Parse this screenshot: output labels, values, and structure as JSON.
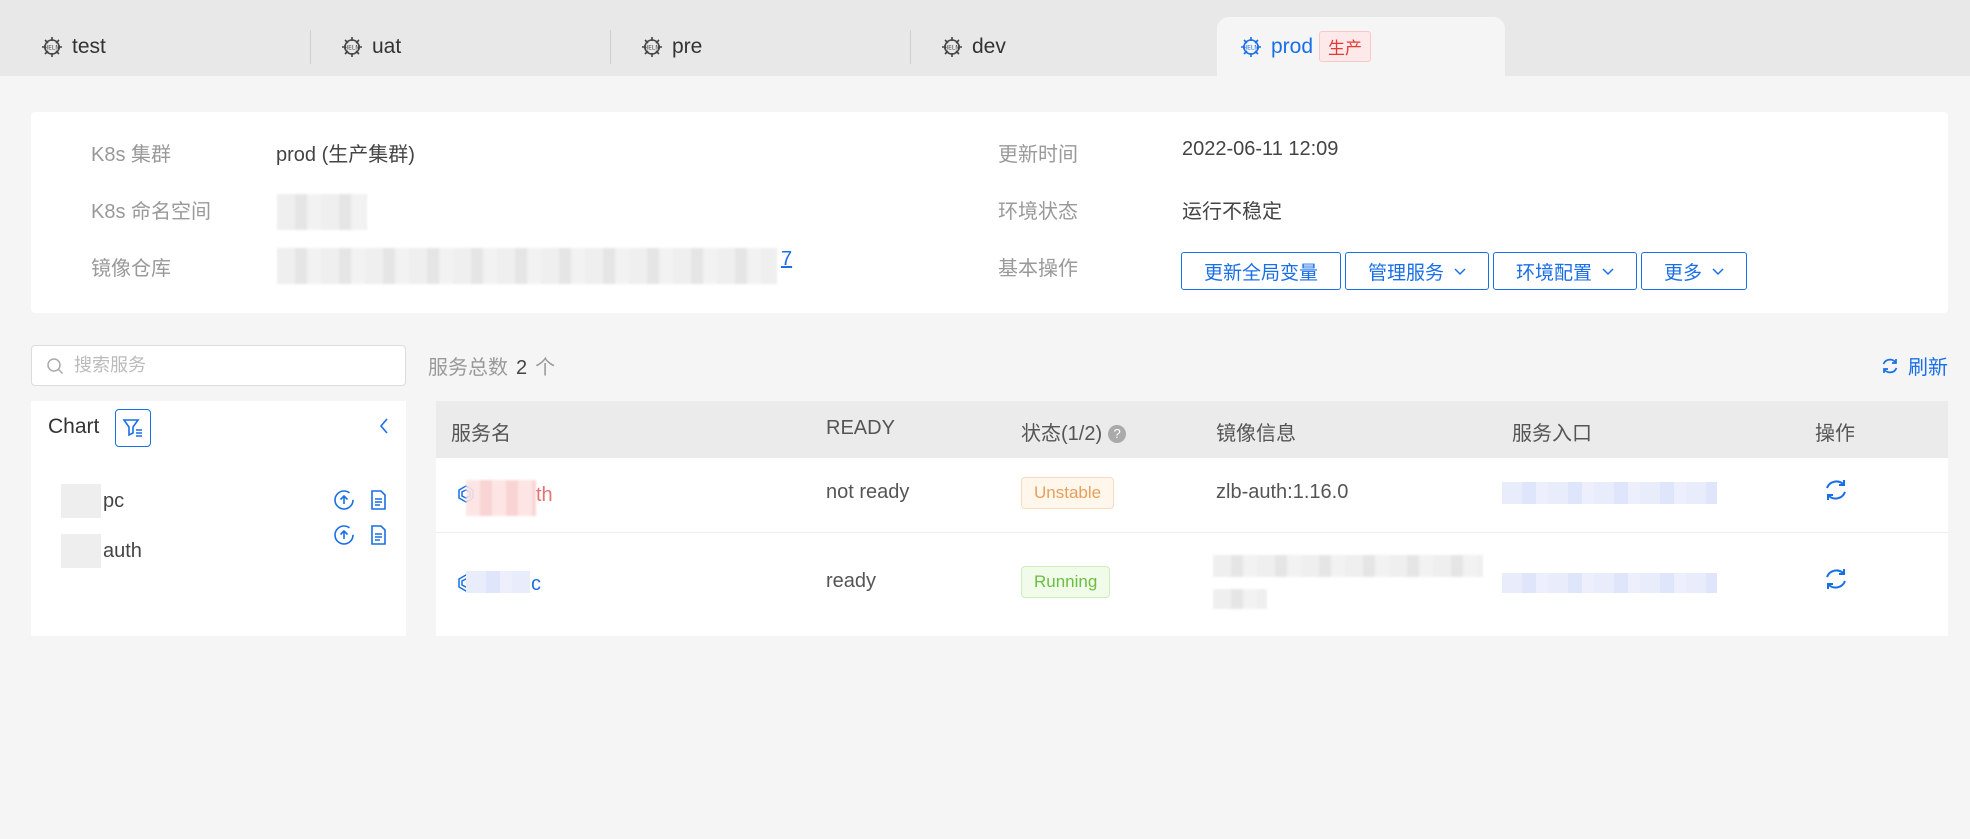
{
  "tabs": [
    {
      "label": "test"
    },
    {
      "label": "uat"
    },
    {
      "label": "pre"
    },
    {
      "label": "dev"
    },
    {
      "label": "prod",
      "tag": "生产",
      "active": true
    }
  ],
  "info": {
    "cluster_label": "K8s 集群",
    "cluster_value": "prod (生产集群)",
    "namespace_label": "K8s 命名空间",
    "registry_label": "镜像仓库",
    "registry_tail": "7",
    "update_time_label": "更新时间",
    "update_time_value": "2022-06-11 12:09",
    "env_status_label": "环境状态",
    "env_status_value": "运行不稳定",
    "basic_ops_label": "基本操作"
  },
  "ops": {
    "update_globals": "更新全局变量",
    "manage_services": "管理服务",
    "env_config": "环境配置",
    "more": "更多"
  },
  "search": {
    "placeholder": "搜索服务"
  },
  "service_count": {
    "label": "服务总数",
    "value": "2",
    "unit": "个"
  },
  "refresh_label": "刷新",
  "chart_panel": {
    "title": "Chart",
    "items": [
      {
        "label_tail": "pc"
      },
      {
        "label_tail": "auth"
      }
    ]
  },
  "table": {
    "headers": {
      "name": "服务名",
      "ready": "READY",
      "status": "状态(1/2)",
      "image": "镜像信息",
      "entry": "服务入口",
      "actions": "操作"
    },
    "rows": [
      {
        "name_tail": "th",
        "ready": "not ready",
        "status": "Unstable",
        "image": "zlb-auth:1.16.0"
      },
      {
        "name_tail": "c",
        "ready": "ready",
        "status": "Running",
        "image": ""
      }
    ]
  },
  "colors": {
    "accent": "#1a6fe6",
    "danger": "#e53935",
    "warning": "#e7a05a",
    "success": "#6abf40"
  }
}
